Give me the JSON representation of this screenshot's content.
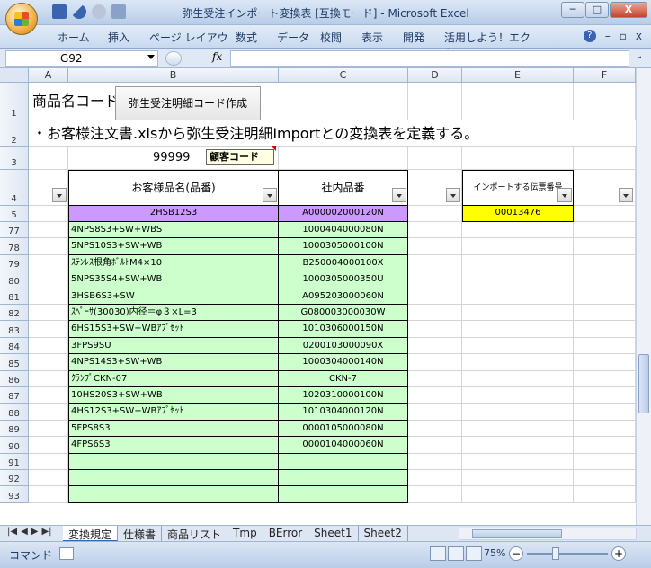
{
  "window": {
    "title": "弥生受注インポート変換表  [互換モード] - Microsoft Excel",
    "minimize_label": "─",
    "maximize_label": "□",
    "close_label": "X"
  },
  "ribbon": {
    "tabs": [
      "ホーム",
      "挿入",
      "ページ レイアウト",
      "数式",
      "データ",
      "校閲",
      "表示",
      "開発",
      "活用しよう！エクセル"
    ],
    "right_min": "–",
    "right_restore": "▫",
    "right_close": "x"
  },
  "formula_bar": {
    "name_box": "G92",
    "fx_label": "fx",
    "value": ""
  },
  "columns": [
    "A",
    "B",
    "C",
    "D",
    "E",
    "F"
  ],
  "sheet": {
    "row1_text": "商品名コード",
    "button_label": "弥生受注明細コード作成",
    "row2_text": "・お客様注文書.xlsから弥生受注明細Importとの変換表を定義する。",
    "row3_value": "99999",
    "customer_code_label": "顧客コード",
    "header_b": "お客様品名(品番)",
    "header_c": "社内品番",
    "header_e": "インポートする伝票番号",
    "row5_b": "2HSB12S3",
    "row5_c": "A000002000120N",
    "row5_e": "00013476"
  },
  "rows": [
    {
      "num": "1"
    },
    {
      "num": "2"
    },
    {
      "num": "3"
    },
    {
      "num": "4"
    },
    {
      "num": "5"
    }
  ],
  "data_rows": [
    {
      "num": "77",
      "b": "4NPS8S3+SW+WBS",
      "c": "1000404000080N"
    },
    {
      "num": "78",
      "b": "5NPS10S3+SW+WB",
      "c": "1000305000100N"
    },
    {
      "num": "79",
      "b": "ｽﾃﾝﾚｽ根角ﾎﾞﾙﾄM4×10",
      "c": "B250004000100X"
    },
    {
      "num": "80",
      "b": "5NPS35S4+SW+WB",
      "c": "1000305000350U"
    },
    {
      "num": "81",
      "b": "3HSB6S3+SW",
      "c": "A095203000060N"
    },
    {
      "num": "82",
      "b": "ｽﾍﾟｰｻ(30030)内径＝φ３×L=3",
      "c": "G080003000030W"
    },
    {
      "num": "83",
      "b": "6HS15S3+SW+WBｱﾌﾟｾｯﾄ",
      "c": "1010306000150N"
    },
    {
      "num": "84",
      "b": "3FPS9SU",
      "c": "0200103000090X"
    },
    {
      "num": "85",
      "b": "4NPS14S3+SW+WB",
      "c": "1000304000140N"
    },
    {
      "num": "86",
      "b": "ｸﾗﾝﾌﾟCKN-07",
      "c": "CKN-7"
    },
    {
      "num": "87",
      "b": "10HS20S3+SW+WB",
      "c": "1020310000100N"
    },
    {
      "num": "88",
      "b": "4HS12S3+SW+WBｱﾌﾟｾｯﾄ",
      "c": "1010304000120N"
    },
    {
      "num": "89",
      "b": "5FPS8S3",
      "c": "0000105000080N"
    },
    {
      "num": "90",
      "b": "4FPS6S3",
      "c": "0000104000060N"
    },
    {
      "num": "91",
      "b": "",
      "c": ""
    },
    {
      "num": "92",
      "b": "",
      "c": ""
    },
    {
      "num": "93",
      "b": "",
      "c": ""
    }
  ],
  "sheet_tabs": [
    "変換規定",
    "仕様書",
    "商品リスト",
    "Tmp",
    "BError",
    "Sheet1",
    "Sheet2"
  ],
  "sheet_nav": [
    "|◀",
    "◀",
    "▶",
    "▶|"
  ],
  "status": {
    "mode": "コマンド",
    "zoom": "75%",
    "zoom_minus": "−",
    "zoom_plus": "+"
  },
  "colors": {
    "green_fill": "#ccffcc",
    "purple_fill": "#cc99ff",
    "yellow_fill": "#ffff00"
  }
}
